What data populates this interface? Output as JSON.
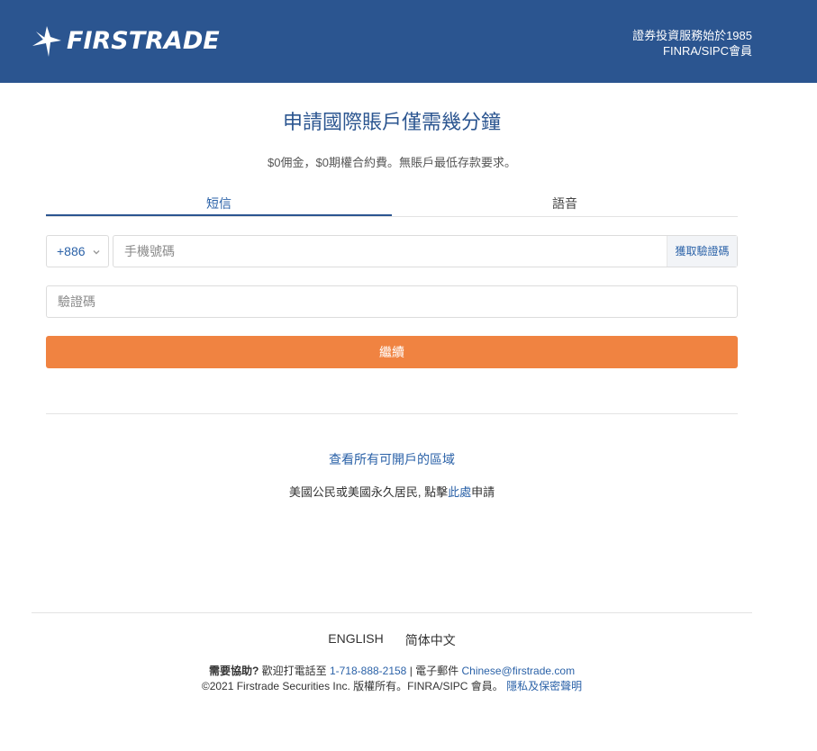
{
  "header": {
    "logo_text": "FIRSTRADE",
    "tagline_line1": "證券投資服務始於1985",
    "tagline_line2": "FINRA/SIPC會員"
  },
  "main": {
    "title": "申請國際賬戶僅需幾分鐘",
    "subtitle": "$0佣金，$0期權合約費。無賬戶最低存款要求。",
    "tabs": [
      {
        "label": "短信",
        "active": true
      },
      {
        "label": "語音",
        "active": false
      }
    ],
    "country_code": "+886",
    "phone_placeholder": "手機號碼",
    "get_code_label": "獲取驗證碼",
    "code_placeholder": "驗證碼",
    "continue_label": "繼續",
    "regions_link": "查看所有可開戶的區域",
    "us_text_before": "美國公民或美國永久居民, 點擊",
    "us_link": "此處",
    "us_text_after": "申請"
  },
  "footer": {
    "languages": [
      "ENGLISH",
      "简体中文"
    ],
    "help_label": "需要協助?",
    "call_text": " 歡迎打電話至 ",
    "phone": "1-718-888-2158",
    "separator": " | ",
    "email_label": " 電子郵件 ",
    "email": "Chinese@firstrade.com",
    "copyright": "©2021 Firstrade Securities Inc. 版權所有。FINRA/SIPC 會員。 ",
    "privacy_link": "隱私及保密聲明"
  },
  "colors": {
    "header_bg": "#2b5590",
    "accent_blue": "#2b62a8",
    "button_orange": "#f08341"
  }
}
